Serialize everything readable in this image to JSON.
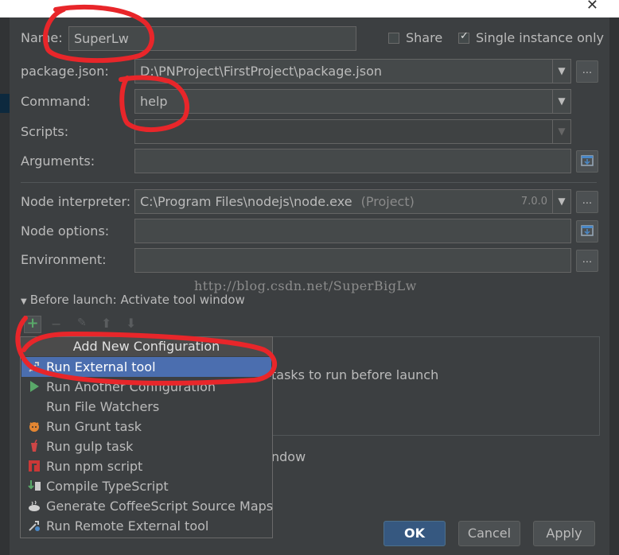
{
  "form": {
    "name_label": "Name:",
    "name_value": "SuperLw",
    "share_label": "Share",
    "share_checked": false,
    "single_instance_label": "Single instance only",
    "single_instance_checked": true,
    "package_json_label": "package.json:",
    "package_json_value": "D:\\PNProject\\FirstProject\\package.json",
    "command_label": "Command:",
    "command_value": "help",
    "scripts_label": "Scripts:",
    "scripts_value": "",
    "arguments_label": "Arguments:",
    "arguments_value": "",
    "node_interpreter_label": "Node interpreter:",
    "node_interpreter_value": "C:\\Program Files\\nodejs\\node.exe",
    "node_interpreter_hint": "(Project)",
    "node_version": "7.0.0",
    "node_options_label": "Node options:",
    "node_options_value": "",
    "environment_label": "Environment:",
    "environment_value": "",
    "browse_label": "..."
  },
  "watermark": "http://blog.csdn.net/SuperBigLw",
  "before_launch": {
    "header": "Before launch: Activate tool window",
    "empty_text": "tasks to run before launch",
    "activate_text": "ndow"
  },
  "popup": {
    "title": "Add New Configuration",
    "items": [
      {
        "label": "Run External tool",
        "icon": "external-tool-icon"
      },
      {
        "label": "Run Another Configuration",
        "icon": "run-triangle-icon"
      },
      {
        "label": "Run File Watchers",
        "icon": ""
      },
      {
        "label": "Run Grunt task",
        "icon": "grunt-icon"
      },
      {
        "label": "Run gulp task",
        "icon": "gulp-icon"
      },
      {
        "label": "Run npm script",
        "icon": "npm-icon"
      },
      {
        "label": "Compile TypeScript",
        "icon": "typescript-icon"
      },
      {
        "label": "Generate CoffeeScript Source Maps",
        "icon": "coffeescript-icon"
      },
      {
        "label": "Run Remote External tool",
        "icon": "remote-tool-icon"
      }
    ],
    "selected_index": 0
  },
  "buttons": {
    "ok": "OK",
    "cancel": "Cancel",
    "apply": "Apply"
  },
  "colors": {
    "background": "#3c3f41",
    "selection": "#4b6eaf",
    "annotation": "#e8262a"
  }
}
